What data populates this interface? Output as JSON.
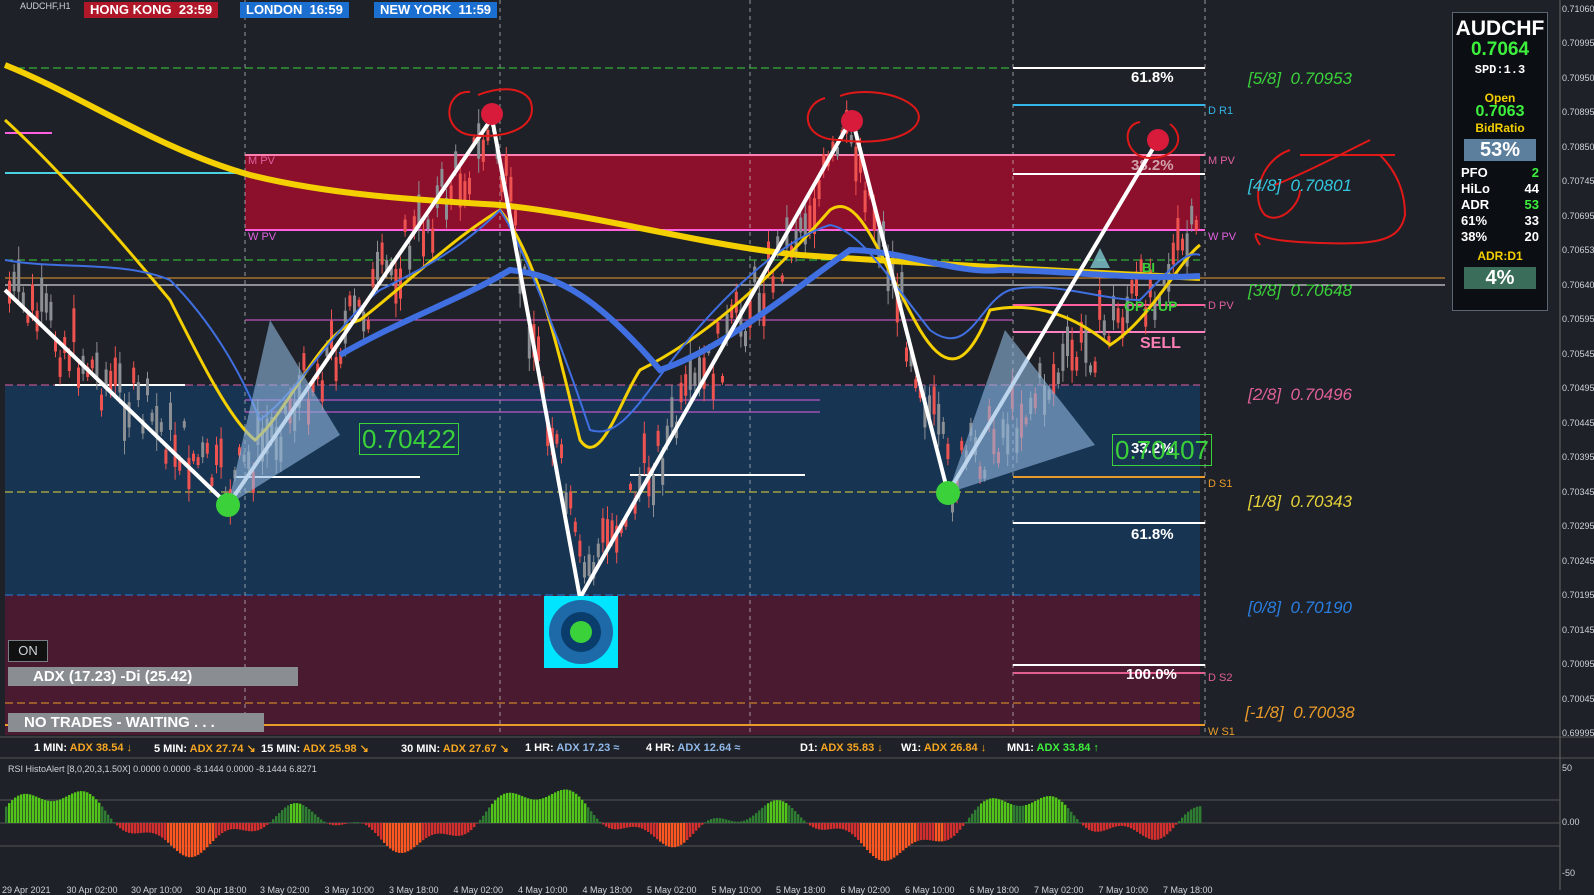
{
  "window": {
    "title": "AUDCHF,H1"
  },
  "clocks": [
    {
      "city": "HONG KONG",
      "time": "23:59",
      "color": "#b0182a"
    },
    {
      "city": "LONDON",
      "time": "16:59",
      "color": "#1b6fd0"
    },
    {
      "city": "NEW YORK",
      "time": "11:59",
      "color": "#1b6fd0"
    }
  ],
  "murrey_levels": [
    {
      "label": "[5/8]",
      "value": "0.70953",
      "color": "#3ad13a"
    },
    {
      "label": "[4/8]",
      "value": "0.70801",
      "color": "#33c8e0"
    },
    {
      "label": "[3/8]",
      "value": "0.70648",
      "color": "#3ad13a"
    },
    {
      "label": "[2/8]",
      "value": "0.70496",
      "color": "#e0609a"
    },
    {
      "label": "[1/8]",
      "value": "0.70343",
      "color": "#e6d23a"
    },
    {
      "label": "[0/8]",
      "value": "0.70190",
      "color": "#2a7ee0"
    },
    {
      "label": "[-1/8]",
      "value": "0.70038",
      "color": "#e89a2a"
    }
  ],
  "pivots": [
    {
      "label": "D R1",
      "color": "#33b5e8"
    },
    {
      "label": "M PV",
      "color": "#e060a0"
    },
    {
      "label": "W PV",
      "color": "#e060e0"
    },
    {
      "label": "D PV",
      "color": "#e060a0"
    },
    {
      "label": "D S1",
      "color": "#e89a2a"
    },
    {
      "label": "D S2",
      "color": "#e06090"
    },
    {
      "label": "W S1",
      "color": "#e89a2a"
    }
  ],
  "left_pivots": {
    "mpv": "M PV",
    "wpv": "W PV"
  },
  "fib_labels": [
    "61.8%",
    "38.2%",
    "33.2%",
    "61.8%",
    "100.0%"
  ],
  "price_boxes": [
    "0.70422",
    "0.70407"
  ],
  "signal_labels": {
    "sell": "SELL",
    "up": "OP... UP",
    "bi": "BI"
  },
  "info_panel": {
    "symbol": "AUDCHF",
    "price": "0.7064",
    "spread": "SPD:1.3",
    "open_label": "Open",
    "open_value": "0.7063",
    "bidratio_label": "BidRatio",
    "bidratio_value": "53%",
    "stats": [
      {
        "name": "PFO",
        "value": "2"
      },
      {
        "name": "HiLo",
        "value": "44"
      },
      {
        "name": "ADR",
        "value": "53"
      },
      {
        "name": "61%",
        "value": "33"
      },
      {
        "name": "38%",
        "value": "20"
      }
    ],
    "adr_label": "ADR:D1",
    "adr_value": "4%"
  },
  "price_axis": [
    "0.71060",
    "0.70995",
    "0.70950",
    "0.70895",
    "0.70850",
    "0.70745",
    "0.70695",
    "0.70653",
    "0.70640",
    "0.70595",
    "0.70545",
    "0.70495",
    "0.70445",
    "0.70395",
    "0.70345",
    "0.70295",
    "0.70245",
    "0.70195",
    "0.70145",
    "0.70095",
    "0.70045",
    "0.69995"
  ],
  "controls": {
    "on_label": "ON"
  },
  "adx_main": "ADX (17.23)  -Di (25.42)",
  "status_message": "NO TRADES - WAITING . . .",
  "adx_timeframes": [
    {
      "tf": "1 MIN:",
      "adx": "ADX 38.54",
      "arrow": "↓",
      "color": "#f5a623"
    },
    {
      "tf": "5 MIN:",
      "adx": "ADX 27.74",
      "arrow": "↘",
      "color": "#f5a623"
    },
    {
      "tf": "15 MIN:",
      "adx": "ADX 25.98",
      "arrow": "↘",
      "color": "#f5a623"
    },
    {
      "tf": "30 MIN:",
      "adx": "ADX 27.67",
      "arrow": "↘",
      "color": "#f5a623"
    },
    {
      "tf": "1 HR:",
      "adx": "ADX 17.23",
      "arrow": "≈",
      "color": "#8fb8e8"
    },
    {
      "tf": "4 HR:",
      "adx": "ADX 12.64",
      "arrow": "≈",
      "color": "#8fb8e8"
    },
    {
      "tf": "D1:",
      "adx": "ADX 35.83",
      "arrow": "↓",
      "color": "#f5a623"
    },
    {
      "tf": "W1:",
      "adx": "ADX 26.84",
      "arrow": "↓",
      "color": "#f5a623"
    },
    {
      "tf": "MN1:",
      "adx": "ADX 33.84",
      "arrow": "↑",
      "color": "#3ef03e"
    }
  ],
  "rsi_indicator": {
    "title": "RSI HistoAlert [8,0,20,3,1.50X] 0.0000 0.0000 -8.1444 0.0000 -8.1444 6.8271",
    "levels": [
      "50",
      "0.00",
      "-50"
    ]
  },
  "time_axis": [
    "29 Apr 2021",
    "30 Apr 02:00",
    "30 Apr 10:00",
    "30 Apr 18:00",
    "3 May 02:00",
    "3 May 10:00",
    "3 May 18:00",
    "4 May 02:00",
    "4 May 10:00",
    "4 May 18:00",
    "5 May 02:00",
    "5 May 10:00",
    "5 May 18:00",
    "6 May 02:00",
    "6 May 10:00",
    "6 May 18:00",
    "7 May 02:00",
    "7 May 10:00",
    "7 May 18:00"
  ],
  "colors": {
    "background": "#1e2127",
    "bull": "#52c41a",
    "bear": "#ef5350",
    "ma_yellow": "#f5d000",
    "ma_blue": "#3f6fe0"
  }
}
